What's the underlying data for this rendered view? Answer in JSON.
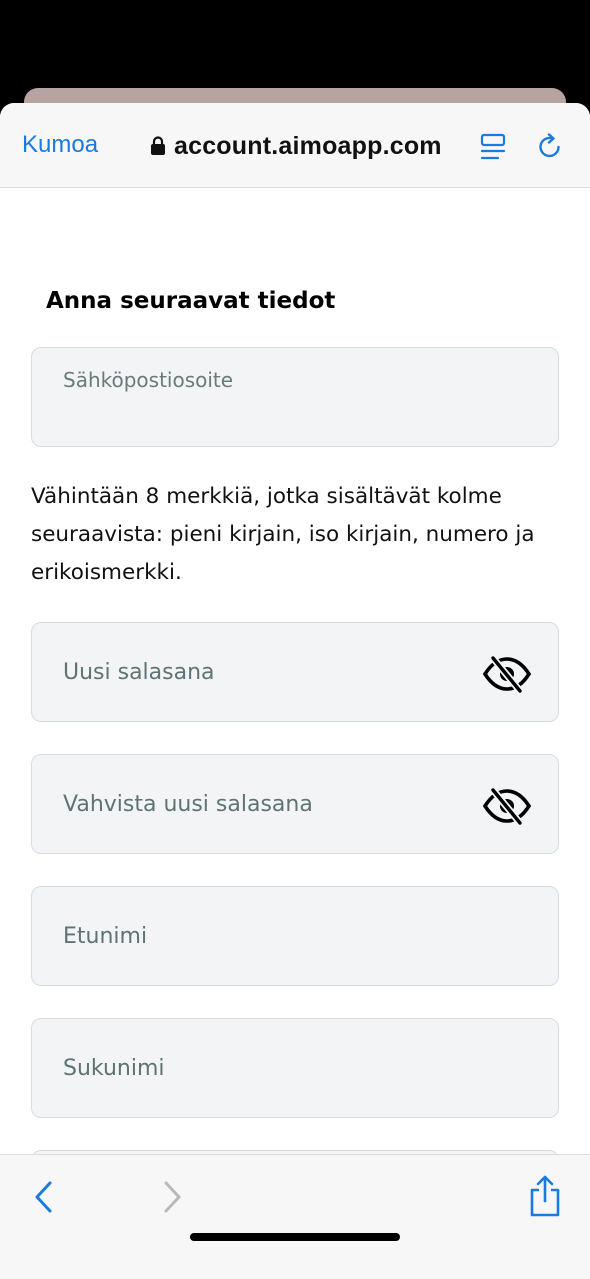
{
  "browser": {
    "cancel_label": "Kumoa",
    "url": "account.aimoapp.com"
  },
  "form": {
    "heading": "Anna seuraavat tiedot",
    "email_label": "Sähköpostiosoite",
    "password_hint": "Vähintään 8 merkkiä, jotka sisältävät kolme seuraavista: pieni kirjain, iso kirjain, numero ja erikoismerkki.",
    "new_password_placeholder": "Uusi salasana",
    "confirm_password_placeholder": "Vahvista uusi salasana",
    "first_name_placeholder": "Etunimi",
    "last_name_placeholder": "Sukunimi"
  },
  "colors": {
    "accent": "#1a7ae0",
    "field_bg": "#f2f4f6",
    "field_border": "#d3dde3",
    "placeholder": "#5f7373"
  },
  "icons": {
    "lock": "lock-icon",
    "reader": "reader-icon",
    "reload": "reload-icon",
    "eye_off": "eye-off-icon",
    "back": "chevron-left-icon",
    "forward": "chevron-right-icon",
    "share": "share-icon"
  }
}
